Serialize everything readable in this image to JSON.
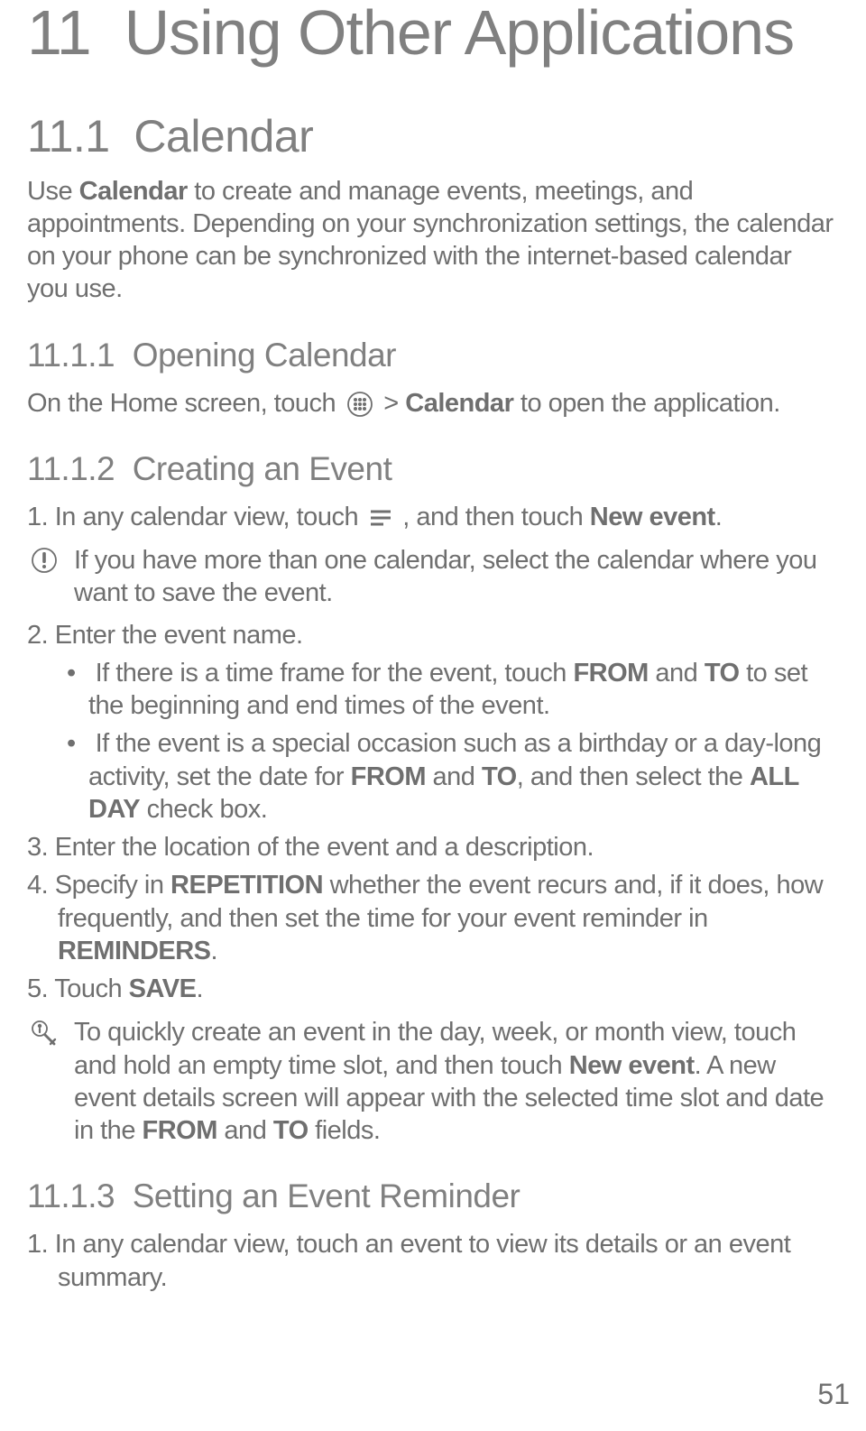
{
  "chapter": {
    "number": "11",
    "title": "Using Other Applications"
  },
  "section_11_1": {
    "number": "11.1",
    "title": "Calendar",
    "intro_pre": "Use ",
    "intro_bold": "Calendar",
    "intro_post": " to create and manage events, meetings, and appointments. Depending on your synchronization settings, the calendar on your phone can be synchronized with the internet-based calendar you use."
  },
  "section_11_1_1": {
    "number": "11.1.1",
    "title": "Opening Calendar",
    "line_pre": "On the Home screen, touch ",
    "line_mid": " > ",
    "line_bold": "Calendar",
    "line_post": " to open the application."
  },
  "section_11_1_2": {
    "number": "11.1.2",
    "title": "Creating an Event",
    "step1_pre": "1. In any calendar view, touch ",
    "step1_mid": " , and then touch ",
    "step1_bold": "New event",
    "step1_post": ".",
    "note1": "If you have more than one calendar, select the calendar where you want to save the event.",
    "step2": "2. Enter the event name.",
    "bullet2a_pre": "If there is a time frame for the event, touch ",
    "bullet2a_b1": "FROM",
    "bullet2a_mid": " and ",
    "bullet2a_b2": "TO",
    "bullet2a_post": " to set the beginning and end times of the event.",
    "bullet2b_pre": "If the event is a special occasion such as a birthday or a day-long activity, set the date for ",
    "bullet2b_b1": "FROM",
    "bullet2b_mid1": " and ",
    "bullet2b_b2": "TO",
    "bullet2b_mid2": ", and then select the ",
    "bullet2b_b3": "ALL DAY",
    "bullet2b_post": " check box.",
    "step3": "3. Enter the location of the event and a description.",
    "step4_pre": "4. Specify in ",
    "step4_b1": "REPETITION",
    "step4_mid": " whether the event recurs and, if it does, how frequently, and then set the time for your event reminder in ",
    "step4_b2": "REMINDERS",
    "step4_post": ".",
    "step5_pre": "5. Touch ",
    "step5_b1": "SAVE",
    "step5_post": ".",
    "note2_pre": "To quickly create an event in the day, week, or month view, touch and hold an empty time slot, and then touch ",
    "note2_b1": "New event",
    "note2_mid1": ". A new event details screen will appear with the selected time slot and date in the ",
    "note2_b2": "FROM",
    "note2_mid2": " and ",
    "note2_b3": "TO",
    "note2_post": " fields."
  },
  "section_11_1_3": {
    "number": "11.1.3",
    "title": "Setting an Event Reminder",
    "step1": "1. In any calendar view, touch an event to view its details or an event summary."
  },
  "page_number": "51"
}
